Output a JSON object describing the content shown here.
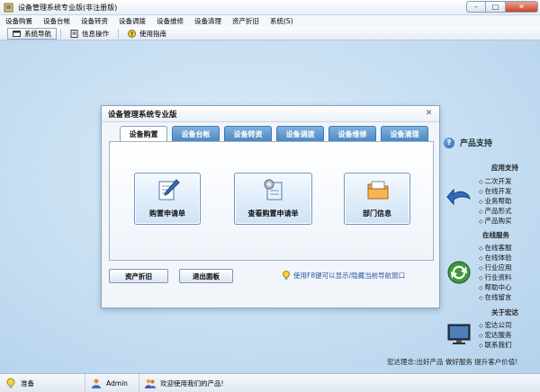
{
  "window": {
    "title": "设备管理系统专业版(非注册版)"
  },
  "menu": [
    "设备购置",
    "设备台帐",
    "设备转资",
    "设备调拨",
    "设备维修",
    "设备清理",
    "资产折旧",
    "系统(S)"
  ],
  "toolbar": {
    "nav": "系统导航",
    "info": "信息操作",
    "guide": "使用指南"
  },
  "dialog": {
    "title": "设备管理系统专业版",
    "tabs": [
      "设备购置",
      "设备台帐",
      "设备转资",
      "设备调拨",
      "设备维修",
      "设备清理"
    ],
    "buttons": {
      "purchase": "购置申请单",
      "query": "查看购置申请单",
      "dept": "部门信息"
    },
    "footer": {
      "depreciation": "资产折旧",
      "exit": "退出面板",
      "hint": "使用F8键可以显示/隐藏当前导航窗口"
    }
  },
  "side": {
    "title": "产品支持",
    "app_support": {
      "heading": "应用支持",
      "items": [
        "二次开发",
        "在线开发",
        "业务帮助",
        "产品形式",
        "产品购买"
      ]
    },
    "online": {
      "heading": "在线服务",
      "items": [
        "在线客服",
        "在线体验",
        "行业应用",
        "行业资料",
        "帮助中心",
        "在线留言"
      ]
    },
    "about": {
      "heading": "关于宏达",
      "items": [
        "宏达公司",
        "宏达服务",
        "联系我们"
      ]
    },
    "slogan": "宏达理念:出好产品  做好服务  提升客户价值!"
  },
  "status": {
    "ready": "准备",
    "user": "Admin",
    "welcome": "欢迎使用我们的产品!"
  },
  "colors": {
    "tab_blue": "#4c89c4",
    "workspace": "#c6def2"
  }
}
